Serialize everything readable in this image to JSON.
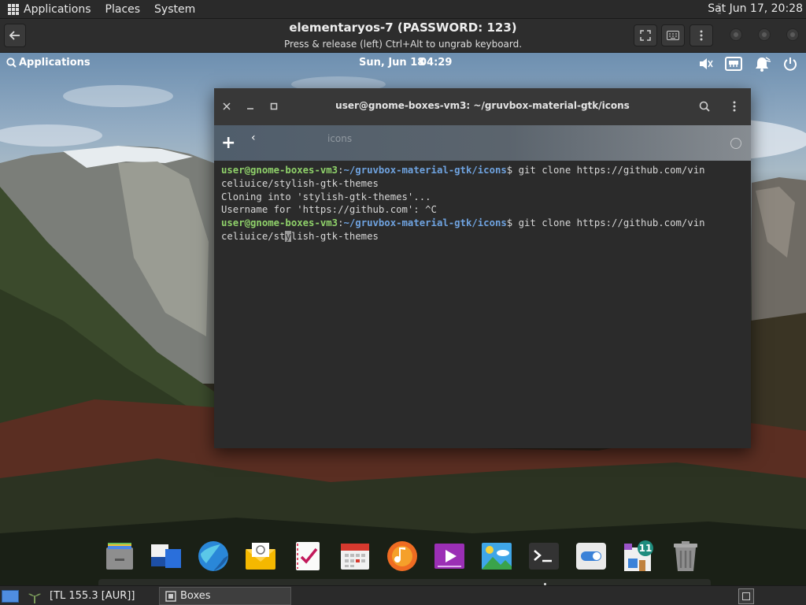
{
  "host_top": {
    "menus": [
      "Applications",
      "Places",
      "System"
    ],
    "clock": "Sat Jun 17, 20:28"
  },
  "boxes": {
    "title": "elementaryos-7 (PASSWORD: 123)",
    "subtitle": "Press & release (left) Ctrl+Alt to ungrab keyboard."
  },
  "vm_panel": {
    "applications": "Applications",
    "date": "Sun, Jun 18",
    "time": "04:29"
  },
  "terminal": {
    "title": "user@gnome-boxes-vm3: ~/gruvbox-material-gtk/icons",
    "tab_ghost": "icons",
    "lines": [
      {
        "user": "user@gnome-boxes-vm3",
        "sep": ":",
        "path": "~/gruvbox-material-gtk/icons",
        "cmd": "$ git clone https://github.com/vin"
      },
      {
        "text": "celiuice/stylish-gtk-themes"
      },
      {
        "text": "Cloning into 'stylish-gtk-themes'..."
      },
      {
        "text": "Username for 'https://github.com': ^C"
      },
      {
        "user": "user@gnome-boxes-vm3",
        "sep": ":",
        "path": "~/gruvbox-material-gtk/icons",
        "cmd": "$ git clone https://github.com/vin"
      },
      {
        "pre": "celiuice/st",
        "cur": "y",
        "post": "lish-gtk-themes"
      }
    ]
  },
  "dock": {
    "items": [
      {
        "name": "files-icon"
      },
      {
        "name": "multitasking-view-icon"
      },
      {
        "name": "web-browser-icon"
      },
      {
        "name": "mail-icon"
      },
      {
        "name": "tasks-icon"
      },
      {
        "name": "calendar-icon"
      },
      {
        "name": "music-icon"
      },
      {
        "name": "videos-icon"
      },
      {
        "name": "photos-icon"
      },
      {
        "name": "terminal-icon"
      },
      {
        "name": "system-settings-icon"
      },
      {
        "name": "appcenter-icon",
        "badge": "11"
      },
      {
        "name": "trash-icon"
      }
    ]
  },
  "host_bottom": {
    "weather": "[TL 155.3 [AUR]]",
    "task": "Boxes"
  },
  "colors": {
    "prompt_user": "#8fd16a",
    "prompt_path": "#6fa3e0",
    "terminal_bg": "#2b2b2b"
  }
}
